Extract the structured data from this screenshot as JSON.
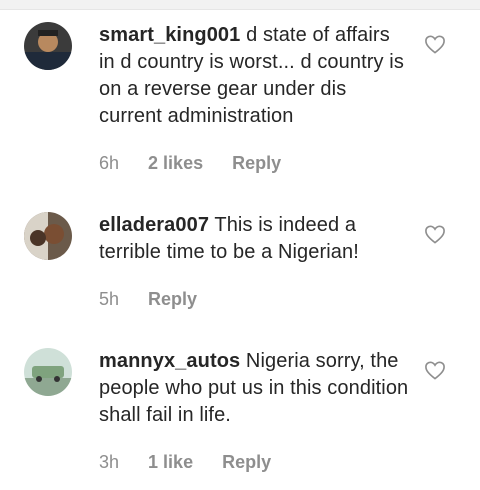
{
  "comments": [
    {
      "username": "smart_king001",
      "text": "d state of affairs in d country is worst... d country is on a reverse gear under dis current administration",
      "time": "6h",
      "likes": "2 likes",
      "reply": "Reply",
      "icons": {
        "avatar": "profile-photo",
        "like": "heart-outline-icon"
      }
    },
    {
      "username": "elladera007",
      "text": "This is indeed a terrible time to be a Nigerian!",
      "time": "5h",
      "likes": "",
      "reply": "Reply",
      "icons": {
        "avatar": "profile-photo",
        "like": "heart-outline-icon"
      }
    },
    {
      "username": "mannyx_autos",
      "text": "Nigeria sorry, the people who put us in this condition shall fail in life.",
      "time": "3h",
      "likes": "1 like",
      "reply": "Reply",
      "icons": {
        "avatar": "profile-photo",
        "like": "heart-outline-icon"
      }
    }
  ],
  "colors": {
    "text": "#262626",
    "muted": "#8e8e8e",
    "divider": "#f2f2f2"
  }
}
